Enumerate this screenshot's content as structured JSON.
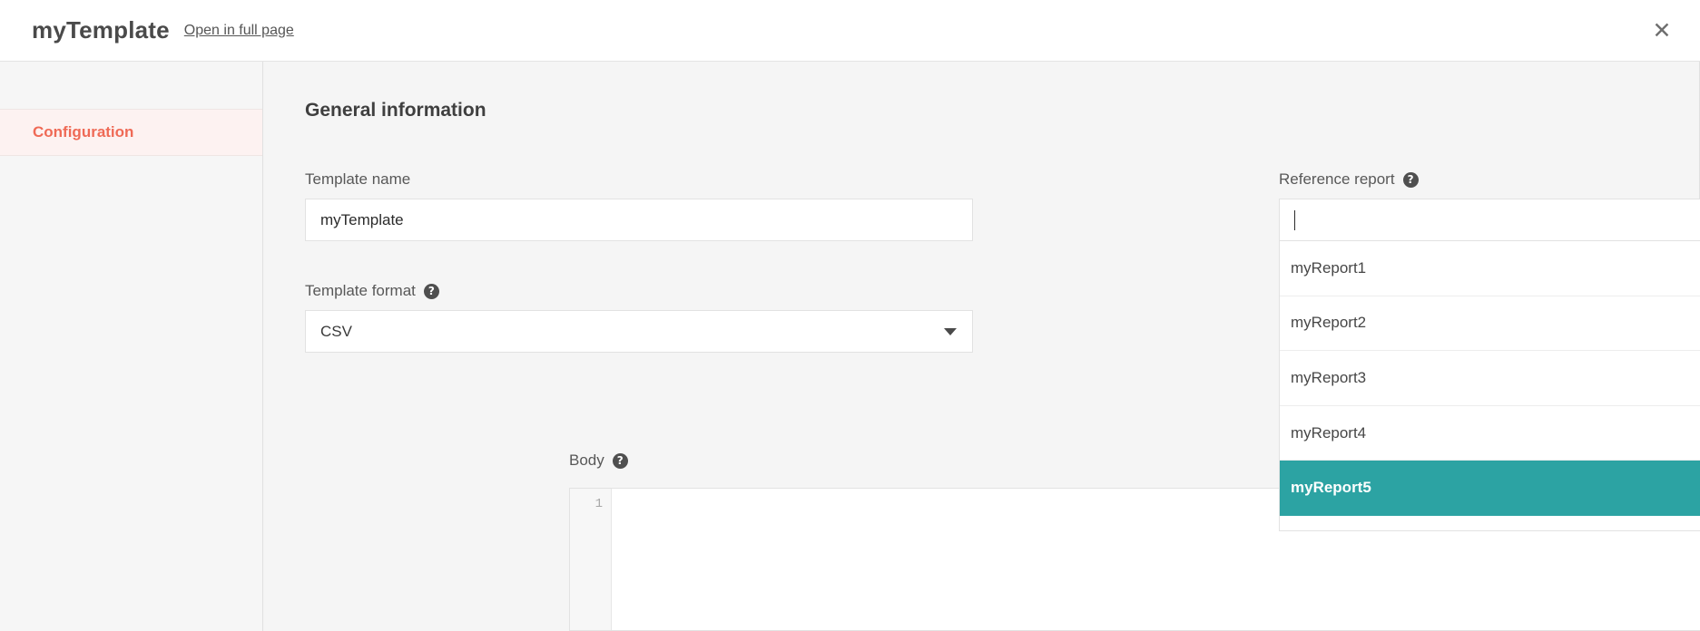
{
  "header": {
    "title": "myTemplate",
    "full_page_link": "Open in full page",
    "close_icon": "close-icon",
    "close_glyph": "✕"
  },
  "sidebar": {
    "items": [
      {
        "label": "Configuration",
        "active": true
      }
    ],
    "active_text_color": "#ef6a56",
    "active_bg_color": "#fdf2f1"
  },
  "main": {
    "section_title": "General information",
    "template_name": {
      "label": "Template name",
      "value": "myTemplate",
      "placeholder": ""
    },
    "template_format": {
      "label": "Template format",
      "help_icon": "help-icon",
      "help_glyph": "?",
      "value": "CSV",
      "caret_icon": "chevron-down-icon"
    },
    "body": {
      "label": "Body",
      "help_icon": "help-icon",
      "help_glyph": "?",
      "line_number": "1",
      "content": ""
    }
  },
  "reference_report": {
    "label": "Reference report",
    "help_icon": "help-icon",
    "help_glyph": "?",
    "input_value": "",
    "clear_icon": "clear-icon",
    "clear_glyph": "✕",
    "toggle_icon": "chevron-up-icon",
    "options": [
      {
        "label": "myReport1",
        "selected": false
      },
      {
        "label": "myReport2",
        "selected": false
      },
      {
        "label": "myReport3",
        "selected": false
      },
      {
        "label": "myReport4",
        "selected": false
      },
      {
        "label": "myReport5",
        "selected": true
      }
    ],
    "selected_option": "myReport5",
    "highlight_color": "#2ca3a3"
  }
}
